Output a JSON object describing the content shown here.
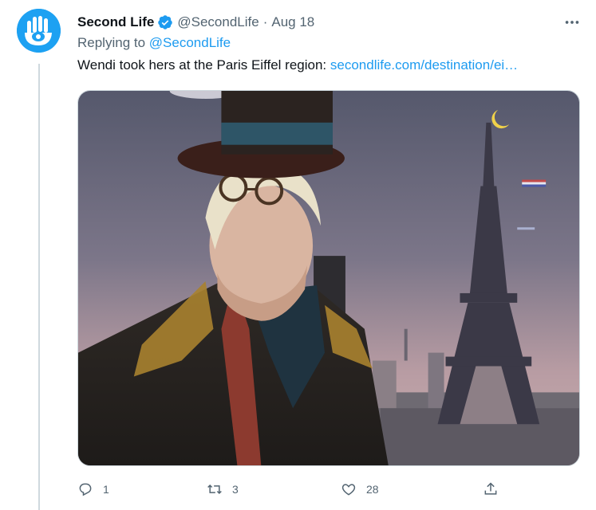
{
  "tweet": {
    "author_name": "Second Life",
    "handle": "@SecondLife",
    "separator": "·",
    "timestamp": "Aug 18",
    "replying_prefix": "Replying to ",
    "replying_to": "@SecondLife",
    "text": "Wendi took hers at the Paris Eiffel region: ",
    "link": "secondlife.com/destination/ei…"
  },
  "actions": {
    "reply_count": "1",
    "retweet_count": "3",
    "like_count": "28"
  },
  "colors": {
    "accent": "#1d9bf0",
    "secondary_text": "#536471",
    "avatar_bg": "#1da1f2"
  },
  "icons": {
    "avatar": "second-life-hand-eye-logo",
    "verified": "verified-badge-icon",
    "more": "more-horizontal-icon",
    "reply": "reply-icon",
    "retweet": "retweet-icon",
    "like": "heart-icon",
    "share": "share-icon"
  }
}
